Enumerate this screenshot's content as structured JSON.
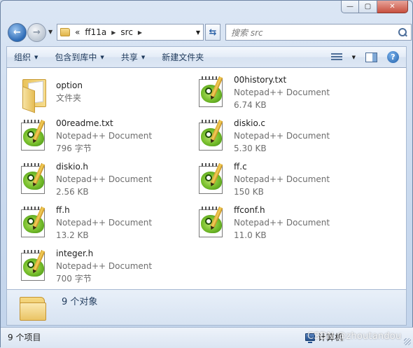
{
  "window": {
    "caption": {
      "minimize": "—",
      "maximize": "▢",
      "close": "✕"
    }
  },
  "nav": {
    "back_glyph": "←",
    "forward_glyph": "→",
    "crumbs_prefix": "«",
    "breadcrumbs": [
      "ff11a",
      "src"
    ],
    "search_placeholder": "搜索 src"
  },
  "toolbar": {
    "organize": "组织",
    "include_in_library": "包含到库中",
    "share": "共享",
    "new_folder": "新建文件夹",
    "help_glyph": "?"
  },
  "items": [
    {
      "name": "option",
      "type": "文件夹",
      "size": "",
      "icon": "folder-icon"
    },
    {
      "name": "00history.txt",
      "type": "Notepad++ Document",
      "size": "6.74 KB",
      "icon": "notepadpp-icon"
    },
    {
      "name": "00readme.txt",
      "type": "Notepad++ Document",
      "size": "796 字节",
      "icon": "notepadpp-icon"
    },
    {
      "name": "diskio.c",
      "type": "Notepad++ Document",
      "size": "5.30 KB",
      "icon": "notepadpp-icon"
    },
    {
      "name": "diskio.h",
      "type": "Notepad++ Document",
      "size": "2.56 KB",
      "icon": "notepadpp-icon"
    },
    {
      "name": "ff.c",
      "type": "Notepad++ Document",
      "size": "150 KB",
      "icon": "notepadpp-icon"
    },
    {
      "name": "ff.h",
      "type": "Notepad++ Document",
      "size": "13.2 KB",
      "icon": "notepadpp-icon"
    },
    {
      "name": "ffconf.h",
      "type": "Notepad++ Document",
      "size": "11.0 KB",
      "icon": "notepadpp-icon"
    },
    {
      "name": "integer.h",
      "type": "Notepad++ Document",
      "size": "700 字节",
      "icon": "notepadpp-icon"
    }
  ],
  "details": {
    "count": "9 个对象"
  },
  "status": {
    "items_count": "9 个项目",
    "computer_label": "计算机",
    "watermark": "CSDN @zhoutandou"
  }
}
